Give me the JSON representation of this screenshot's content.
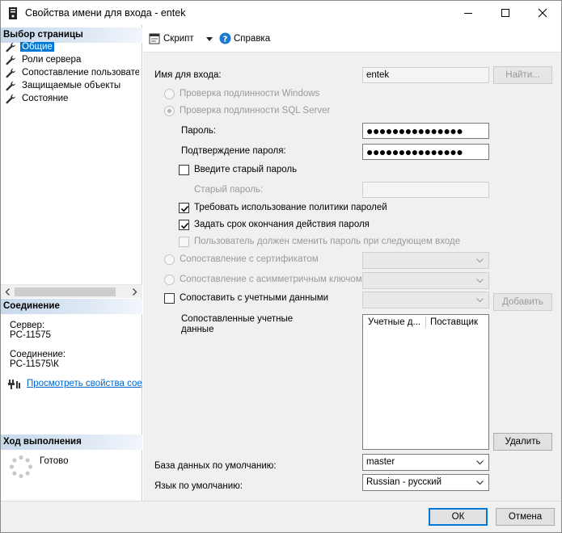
{
  "window": {
    "title": "Свойства имени для входа - entek"
  },
  "left": {
    "select_page_header": "Выбор страницы",
    "nav_items": [
      {
        "label": "Общие",
        "selected": true
      },
      {
        "label": "Роли сервера",
        "selected": false
      },
      {
        "label": "Сопоставление пользователей",
        "selected": false
      },
      {
        "label": "Защищаемые объекты",
        "selected": false
      },
      {
        "label": "Состояние",
        "selected": false
      }
    ],
    "connection_header": "Соединение",
    "server_label": "Сервер:",
    "server_value": "PC-11575",
    "connection_label": "Соединение:",
    "connection_value": "PC-11575\\К",
    "view_props_link": "Просмотреть свойства соединения",
    "progress_header": "Ход выполнения",
    "progress_status": "Готово"
  },
  "toolbar": {
    "script_label": "Скрипт",
    "help_label": "Справка"
  },
  "form": {
    "login_name_label": "Имя для входа:",
    "login_name_value": "entek",
    "find_button": "Найти...",
    "windows_auth_label": "Проверка подлинности Windows",
    "sql_auth_label": "Проверка подлинности SQL Server",
    "password_label": "Пароль:",
    "password_value": "●●●●●●●●●●●●●●●",
    "confirm_label": "Подтверждение пароля:",
    "confirm_value": "●●●●●●●●●●●●●●●",
    "old_password_check_label": "Введите старый пароль",
    "old_password_label": "Старый пароль:",
    "enforce_policy_label": "Требовать использование политики паролей",
    "enforce_expiration_label": "Задать срок окончания действия пароля",
    "must_change_label": "Пользователь должен сменить пароль при следующем входе",
    "cert_mapping_label": "Сопоставление с сертификатом",
    "asym_key_mapping_label": "Сопоставление с асимметричным ключом",
    "credential_mapping_label": "Сопоставить с учетными данными",
    "add_button": "Добавить",
    "mapped_creds_label_line1": "Сопоставленные учетные",
    "mapped_creds_label_line2": "данные",
    "grid_col_credential": "Учетные д...",
    "grid_col_provider": "Поставщик",
    "remove_button": "Удалить",
    "default_db_label": "База данных по умолчанию:",
    "default_db_value": "master",
    "default_lang_label": "Язык по умолчанию:",
    "default_lang_value": "Russian - русский"
  },
  "footer": {
    "ok_button": "ОК",
    "cancel_button": "Отмена"
  },
  "colors": {
    "selection": "#0078d7",
    "link": "#0066cc",
    "content_bg": "#f0f0f0"
  }
}
